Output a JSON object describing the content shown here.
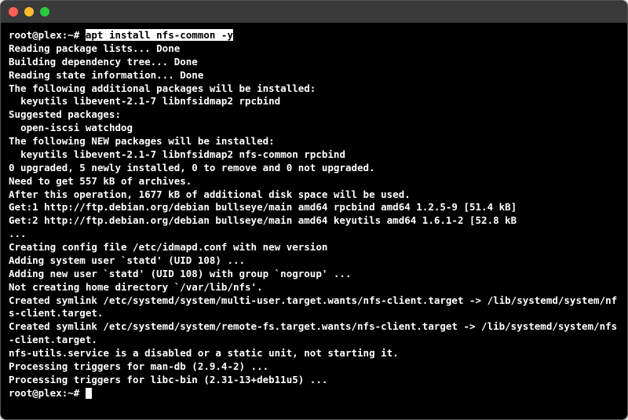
{
  "prompt1": "root@plex:~# ",
  "command": "apt install nfs-common -y",
  "output": [
    "Reading package lists... Done",
    "Building dependency tree... Done",
    "Reading state information... Done",
    "The following additional packages will be installed:",
    "  keyutils libevent-2.1-7 libnfsidmap2 rpcbind",
    "Suggested packages:",
    "  open-iscsi watchdog",
    "The following NEW packages will be installed:",
    "  keyutils libevent-2.1-7 libnfsidmap2 nfs-common rpcbind",
    "0 upgraded, 5 newly installed, 0 to remove and 0 not upgraded.",
    "Need to get 557 kB of archives.",
    "After this operation, 1677 kB of additional disk space will be used.",
    "Get:1 http://ftp.debian.org/debian bullseye/main amd64 rpcbind amd64 1.2.5-9 [51.4 kB]",
    "Get:2 http://ftp.debian.org/debian bullseye/main amd64 keyutils amd64 1.6.1-2 [52.8 kB",
    "...",
    "Creating config file /etc/idmapd.conf with new version",
    "Adding system user `statd' (UID 108) ...",
    "Adding new user `statd' (UID 108) with group `nogroup' ...",
    "Not creating home directory `/var/lib/nfs'.",
    "Created symlink /etc/systemd/system/multi-user.target.wants/nfs-client.target -> /lib/systemd/system/nfs-client.target.",
    "Created symlink /etc/systemd/system/remote-fs.target.wants/nfs-client.target -> /lib/systemd/system/nfs-client.target.",
    "nfs-utils.service is a disabled or a static unit, not starting it.",
    "Processing triggers for man-db (2.9.4-2) ...",
    "Processing triggers for libc-bin (2.31-13+deb11u5) ..."
  ],
  "prompt2": "root@plex:~# "
}
